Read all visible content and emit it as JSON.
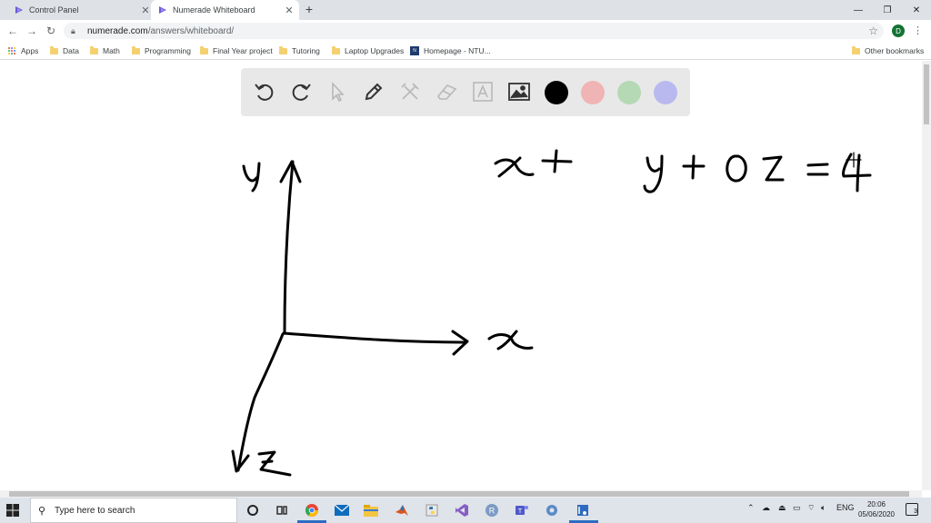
{
  "tabs": [
    {
      "title": "Control Panel",
      "active": false
    },
    {
      "title": "Numerade Whiteboard",
      "active": true
    }
  ],
  "address": {
    "domain": "numerade.com",
    "path": "/answers/whiteboard/"
  },
  "profile_initial": "D",
  "bookmarks": [
    {
      "label": "Apps",
      "icon": "apps-grid-icon"
    },
    {
      "label": "Data",
      "icon": "folder-icon"
    },
    {
      "label": "Math",
      "icon": "folder-icon"
    },
    {
      "label": "Programming",
      "icon": "folder-icon"
    },
    {
      "label": "Final Year project",
      "icon": "folder-icon"
    },
    {
      "label": "Tutoring",
      "icon": "folder-icon"
    },
    {
      "label": "Laptop Upgrades",
      "icon": "folder-icon"
    },
    {
      "label": "Homepage - NTU...",
      "icon": "ntu-icon"
    }
  ],
  "other_bookmarks": "Other bookmarks",
  "whiteboard": {
    "tools": [
      "undo-icon",
      "redo-icon",
      "pointer-icon",
      "pen-icon",
      "tools-icon",
      "eraser-icon",
      "text-icon",
      "image-icon"
    ],
    "colors": [
      "#000000",
      "#f0b4b4",
      "#b4d9b4",
      "#b9b9f0"
    ],
    "selected_color": "#000000"
  },
  "taskbar": {
    "search_placeholder": "Type here to search",
    "language": "ENG",
    "time": "20:06",
    "date": "05/06/2020",
    "notification_count": "3"
  }
}
